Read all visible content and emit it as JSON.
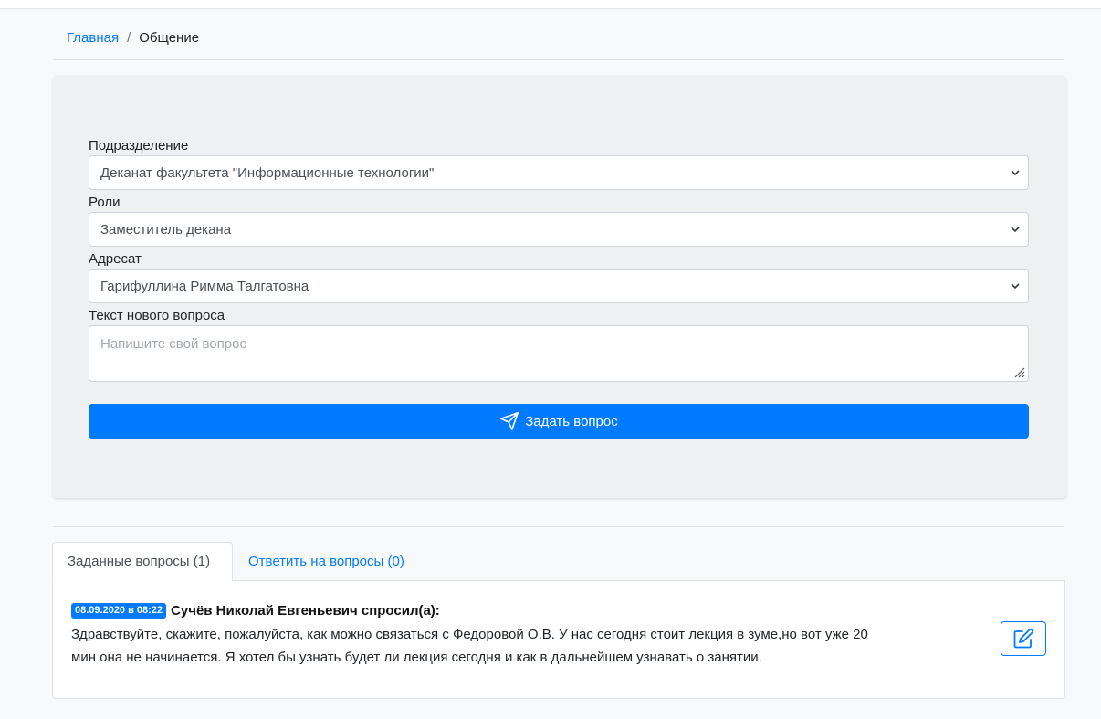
{
  "breadcrumb": {
    "home": "Главная",
    "separator": "/",
    "current": "Общение"
  },
  "form": {
    "department_label": "Подразделение",
    "department_value": "Деканат факультета \"Информационные технологии\"",
    "role_label": "Роли",
    "role_value": "Заместитель декана",
    "recipient_label": "Адресат",
    "recipient_value": "Гарифуллина Римма Талгатовна",
    "question_label": "Текст нового вопроса",
    "question_placeholder": "Напишите свой вопрос",
    "submit_label": "Задать вопрос"
  },
  "tabs": [
    {
      "label": "Заданные вопросы (1)",
      "active": true
    },
    {
      "label": "Ответить на вопросы (0)",
      "active": false
    }
  ],
  "questions": [
    {
      "date": "08.09.2020 в 08:22",
      "author": "Сучёв Николай Евгеньевич спросил(а):",
      "text": "Здравствуйте, скажите, пожалуйста, как можно связаться с Федоровой О.В. У нас сегодня стоит лекция в зуме,но вот уже 20 мин она не начинается. Я хотел бы узнать будет ли лекция сегодня и как в дальнейшем узнавать о занятии."
    }
  ],
  "colors": {
    "accent": "#007bff",
    "panel_bg": "#eff0f2",
    "page_bg": "#f8f9fa"
  },
  "icons": {
    "submit": "send-icon",
    "edit": "edit-icon",
    "select": "chevron-down-icon"
  }
}
